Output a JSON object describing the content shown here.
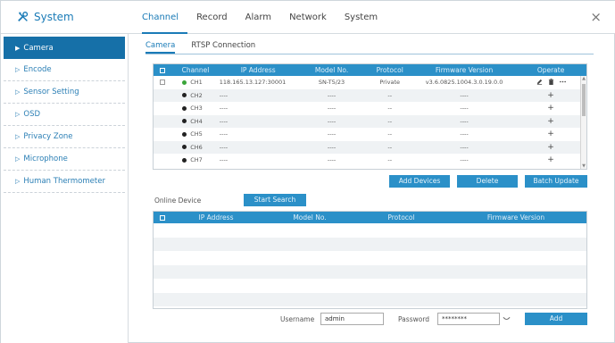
{
  "header": {
    "title": "System",
    "tabs": [
      "Channel",
      "Record",
      "Alarm",
      "Network",
      "System"
    ],
    "active_tab": "Channel",
    "close": "×"
  },
  "sidebar": {
    "items": [
      {
        "label": "Camera",
        "active": true
      },
      {
        "label": "Encode"
      },
      {
        "label": "Sensor Setting"
      },
      {
        "label": "OSD"
      },
      {
        "label": "Privacy Zone"
      },
      {
        "label": "Microphone"
      },
      {
        "label": "Human Thermometer"
      }
    ]
  },
  "subtabs": [
    "Camera",
    "RTSP Connection"
  ],
  "channel_table": {
    "headers": [
      "Channel",
      "IP Address",
      "Model No.",
      "Protocol",
      "Firmware Version",
      "Operate"
    ],
    "rows": [
      {
        "channel": "CH1",
        "status": "online",
        "ip": "118.165.13.127:30001",
        "model": "SN-T5/23",
        "protocol": "Private",
        "firmware": "v3.6.0825.1004.3.0.19.0.0",
        "op": "edit"
      },
      {
        "channel": "CH2",
        "status": "offline",
        "ip": "----",
        "model": "----",
        "protocol": "--",
        "firmware": "----",
        "op": "+"
      },
      {
        "channel": "CH3",
        "status": "offline",
        "ip": "----",
        "model": "----",
        "protocol": "--",
        "firmware": "----",
        "op": "+"
      },
      {
        "channel": "CH4",
        "status": "offline",
        "ip": "----",
        "model": "----",
        "protocol": "--",
        "firmware": "----",
        "op": "+"
      },
      {
        "channel": "CH5",
        "status": "offline",
        "ip": "----",
        "model": "----",
        "protocol": "--",
        "firmware": "----",
        "op": "+"
      },
      {
        "channel": "CH6",
        "status": "offline",
        "ip": "----",
        "model": "----",
        "protocol": "--",
        "firmware": "----",
        "op": "+"
      },
      {
        "channel": "CH7",
        "status": "offline",
        "ip": "----",
        "model": "----",
        "protocol": "--",
        "firmware": "----",
        "op": "+"
      }
    ]
  },
  "buttons": {
    "add_devices": "Add Devices",
    "delete": "Delete",
    "batch_update": "Batch Update",
    "start_search": "Start Search",
    "add": "Add"
  },
  "online_device": {
    "label": "Online Device",
    "headers": [
      "IP Address",
      "Model No.",
      "Protocol",
      "Firmware Version"
    ],
    "rows": []
  },
  "login": {
    "username_label": "Username",
    "username_value": "admin",
    "password_label": "Password",
    "password_value": "********"
  },
  "colors": {
    "accent": "#1a7bb7",
    "header_bg": "#2b90c8",
    "sidebar_active": "#1670a8",
    "online": "#3aa53a",
    "offline": "#222222"
  }
}
